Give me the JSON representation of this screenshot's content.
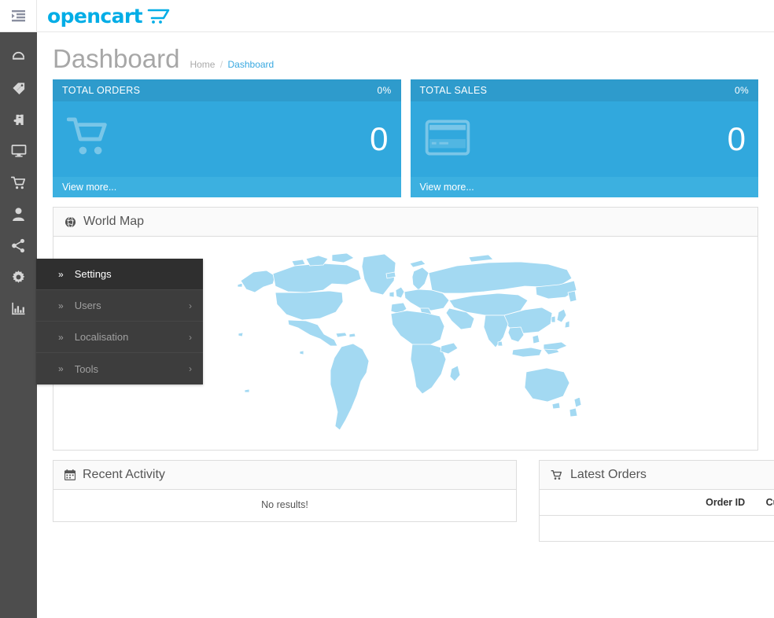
{
  "header": {
    "toggle_icon": "list-indent-icon",
    "brand_name": "opencart",
    "brand_icon": "cart-logo-icon"
  },
  "sidebar": {
    "items": [
      {
        "icon": "dashboard-gauge-icon",
        "name": "dashboard"
      },
      {
        "icon": "tag-icon",
        "name": "catalog"
      },
      {
        "icon": "puzzle-piece-icon",
        "name": "extensions"
      },
      {
        "icon": "monitor-icon",
        "name": "design"
      },
      {
        "icon": "shopping-cart-icon",
        "name": "sales"
      },
      {
        "icon": "user-icon",
        "name": "customers"
      },
      {
        "icon": "share-nodes-icon",
        "name": "marketing"
      },
      {
        "icon": "gear-icon",
        "name": "system"
      },
      {
        "icon": "bar-chart-icon",
        "name": "reports"
      }
    ]
  },
  "page": {
    "title": "Dashboard",
    "breadcrumb": [
      {
        "label": "Home",
        "active": false
      },
      {
        "label": "Dashboard",
        "active": true
      }
    ],
    "breadcrumb_separator": "/"
  },
  "tiles": [
    {
      "label": "TOTAL ORDERS",
      "percent": "0%",
      "value": "0",
      "footer": "View more...",
      "icon": "shopping-cart-icon",
      "header_color": "#2e9bcc",
      "body_color": "#31a8dd",
      "footer_color": "#3cb0e0"
    },
    {
      "label": "TOTAL SALES",
      "percent": "0%",
      "value": "0",
      "footer": "View more...",
      "icon": "credit-card-icon",
      "header_color": "#2e9bcc",
      "body_color": "#31a8dd",
      "footer_color": "#3cb0e0"
    }
  ],
  "world_map_panel": {
    "title": "World Map",
    "icon": "globe-icon",
    "map_fill": "#a3d9f2",
    "map_stroke": "#ffffff"
  },
  "recent_activity_panel": {
    "title": "Recent Activity",
    "icon": "calendar-icon",
    "empty_text": "No results!"
  },
  "latest_orders_panel": {
    "title": "Latest Orders",
    "icon": "shopping-cart-icon",
    "columns": [
      "Order ID",
      "Customer"
    ],
    "rows": []
  },
  "flyout_menu": {
    "items": [
      {
        "label": "Settings",
        "active": true,
        "has_submenu": false,
        "chevron": "»"
      },
      {
        "label": "Users",
        "active": false,
        "has_submenu": true,
        "chevron": "»",
        "caret": "›"
      },
      {
        "label": "Localisation",
        "active": false,
        "has_submenu": true,
        "chevron": "»",
        "caret": "›"
      },
      {
        "label": "Tools",
        "active": false,
        "has_submenu": true,
        "chevron": "»",
        "caret": "›"
      }
    ]
  },
  "colors": {
    "accent": "#31a8dd",
    "brand": "#00ade6",
    "rail_bg": "#4d4d4d",
    "menu_bg": "#3d3d3d",
    "menu_active_bg": "#2f2f2f",
    "link": "#38a8e0"
  }
}
